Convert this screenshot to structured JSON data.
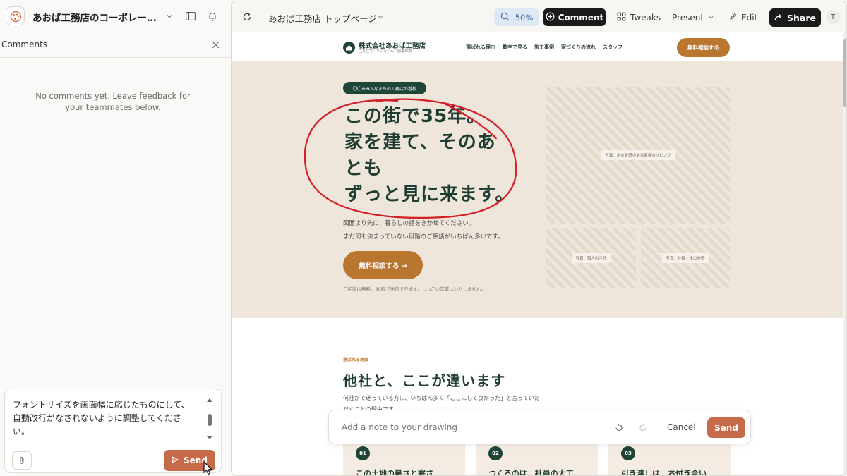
{
  "app": {
    "project_title": "あおば工務店のコーポレート…",
    "panel_title": "Comments",
    "empty_message": "No comments yet. Leave feedback for your teammates below.",
    "composer_text": "フォントサイズを画面幅に応じたものにして、自動改行がなされないように調整してください。",
    "send_label": "Send"
  },
  "toolbar": {
    "page_title": "あおば工務店 トップページ",
    "zoom": "50%",
    "comment_label": "Comment",
    "tweaks_label": "Tweaks",
    "present_label": "Present",
    "edit_label": "Edit",
    "share_label": "Share",
    "avatar_initial": "T"
  },
  "site": {
    "company_name": "株式会社あおば工務店",
    "company_sub": "注文住宅・リフォーム／創業35年",
    "nav_links": [
      "選ばれる理由",
      "数字で見る",
      "施工事例",
      "家づくりの流れ",
      "スタッフ"
    ],
    "nav_cta": "無料相談する",
    "hero": {
      "eyebrow": "〇〇市みんなまちの工務店の看板",
      "headline_lines": [
        "この街で35年。",
        "家を建て、そのあ",
        "とも",
        "ずっと見に来ます。"
      ],
      "lead_lines": [
        "図面より先に、暮らしの話をきかせてください。",
        "まだ何も決まっていない段階のご相談がいちばん多いです。"
      ],
      "cta": "無料相談する →",
      "note": "ご相談は無料。30秒で送信できます。しつこい営業はいたしません。",
      "photo_main": "写真：木の質感のある家族のリビング",
      "photo_left": "写真：職人の手元",
      "photo_right": "写真：外観／木の外壁"
    },
    "reasons": {
      "eyebrow": "選ばれる理由",
      "title": "他社と、ここが違います",
      "desc_lines": [
        "何社かで迷っている方に、いちばん多く「ここにして良かった」と言っていた",
        "だくことの理由です。"
      ],
      "cards": [
        {
          "num": "01",
          "title": "この土地の暑さと寒さ"
        },
        {
          "num": "02",
          "title": "つくるのは、社員の大工"
        },
        {
          "num": "03",
          "title": "引き渡しは、お付き合い"
        }
      ]
    }
  },
  "drawbar": {
    "placeholder": "Add a note to your drawing",
    "cancel_label": "Cancel",
    "send_label": "Send"
  },
  "colors": {
    "accent_brown": "#b9762f",
    "brand_green": "#1f4538",
    "send_orange": "#c76a4a",
    "scribble_red": "#d4202a"
  }
}
